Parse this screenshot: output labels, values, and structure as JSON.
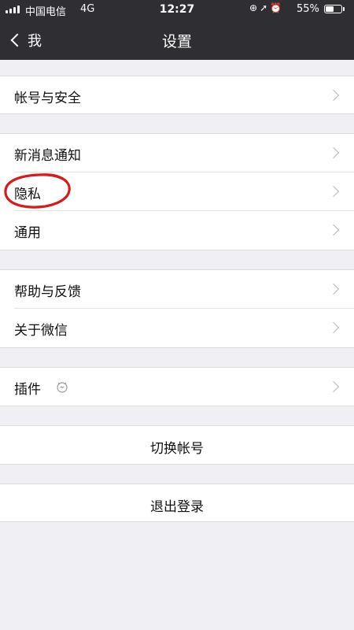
{
  "status_bar": {
    "carrier": "中国电信",
    "network": "4G",
    "time": "12:27",
    "icons": [
      "lock-rotation-icon",
      "location-icon",
      "alarm-icon"
    ],
    "battery_percent_text": "55%",
    "battery_level": 0.55
  },
  "nav": {
    "back_label": "我",
    "title": "设置"
  },
  "menu": {
    "account_security": "帐号与安全",
    "new_message_notify": "新消息通知",
    "privacy": "隐私",
    "general": "通用",
    "help_feedback": "帮助与反馈",
    "about_wechat": "关于微信",
    "plugins": "插件"
  },
  "actions": {
    "switch_account": "切换帐号",
    "logout": "退出登录"
  },
  "colors": {
    "nav_background": "#2e2e33",
    "page_background": "#efeff4",
    "annotation_circle": "#d81a1a"
  }
}
